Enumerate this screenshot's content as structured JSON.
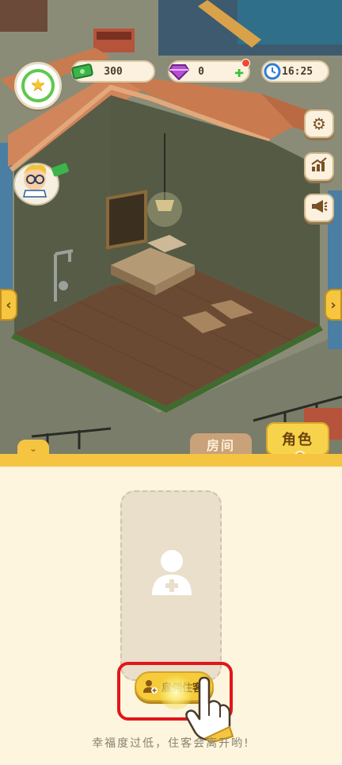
{
  "hud": {
    "money": "300",
    "gems": "0",
    "clock": "16:25",
    "colors": {
      "money": "#3bb54a",
      "gem": "#b44fd6",
      "clock": "#2f7fd6",
      "level_ring": "#5ec94a",
      "star": "#f7c52c"
    }
  },
  "side_buttons": [
    {
      "icon": "gear-icon"
    },
    {
      "icon": "chart-up-icon"
    },
    {
      "icon": "megaphone-icon"
    }
  ],
  "tabs": {
    "room": "房间",
    "character": "角色",
    "collapse": "⌄"
  },
  "panel": {
    "hire_button_label": "雇佣住客",
    "warning": "幸福度过低，住客会离开哟!"
  },
  "colors": {
    "accent_yellow": "#f5c542",
    "panel_bg": "#fdf5dd",
    "highlight_red": "#e2161b"
  }
}
